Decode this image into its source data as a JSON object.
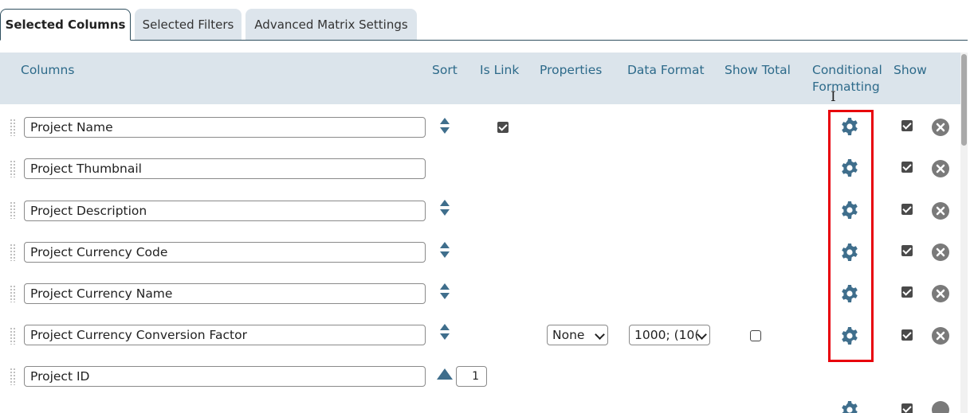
{
  "tabs": [
    {
      "label": "Selected Columns",
      "active": true
    },
    {
      "label": "Selected Filters",
      "active": false
    },
    {
      "label": "Advanced Matrix Settings",
      "active": false
    }
  ],
  "headers": {
    "columns": "Columns",
    "sort": "Sort",
    "is_link": "Is Link",
    "properties": "Properties",
    "data_format": "Data Format",
    "show_total": "Show Total",
    "conditional_formatting_line1": "Conditional",
    "conditional_formatting_line2": "Formatting",
    "show": "Show"
  },
  "rows": [
    {
      "name": "Project Name",
      "sortable": true,
      "is_link": true,
      "gear": true,
      "show": true,
      "remove": true
    },
    {
      "name": "Project Thumbnail",
      "sortable": false,
      "is_link": false,
      "gear": true,
      "show": true,
      "remove": true
    },
    {
      "name": "Project Description",
      "sortable": true,
      "is_link": false,
      "gear": true,
      "show": true,
      "remove": true
    },
    {
      "name": "Project Currency Code",
      "sortable": true,
      "is_link": false,
      "gear": true,
      "show": true,
      "remove": true
    },
    {
      "name": "Project Currency Name",
      "sortable": true,
      "is_link": false,
      "gear": true,
      "show": true,
      "remove": true
    },
    {
      "name": "Project Currency Conversion Factor",
      "sortable": true,
      "is_link": false,
      "properties": "None",
      "data_format": "1000; (10(",
      "show_total": false,
      "gear": true,
      "show": true,
      "remove": true
    },
    {
      "name": "Project ID",
      "sort_asc": true,
      "sort_order": "1"
    }
  ],
  "icons": {
    "gear": "gear-icon",
    "remove": "close-circle-icon",
    "sort": "sort-arrows-icon",
    "grip": "drag-handle-icon"
  },
  "colors": {
    "header_bg": "#dbe4eb",
    "header_text": "#2d6a8a",
    "gear": "#3f6e8c",
    "highlight": "#e8000b"
  }
}
